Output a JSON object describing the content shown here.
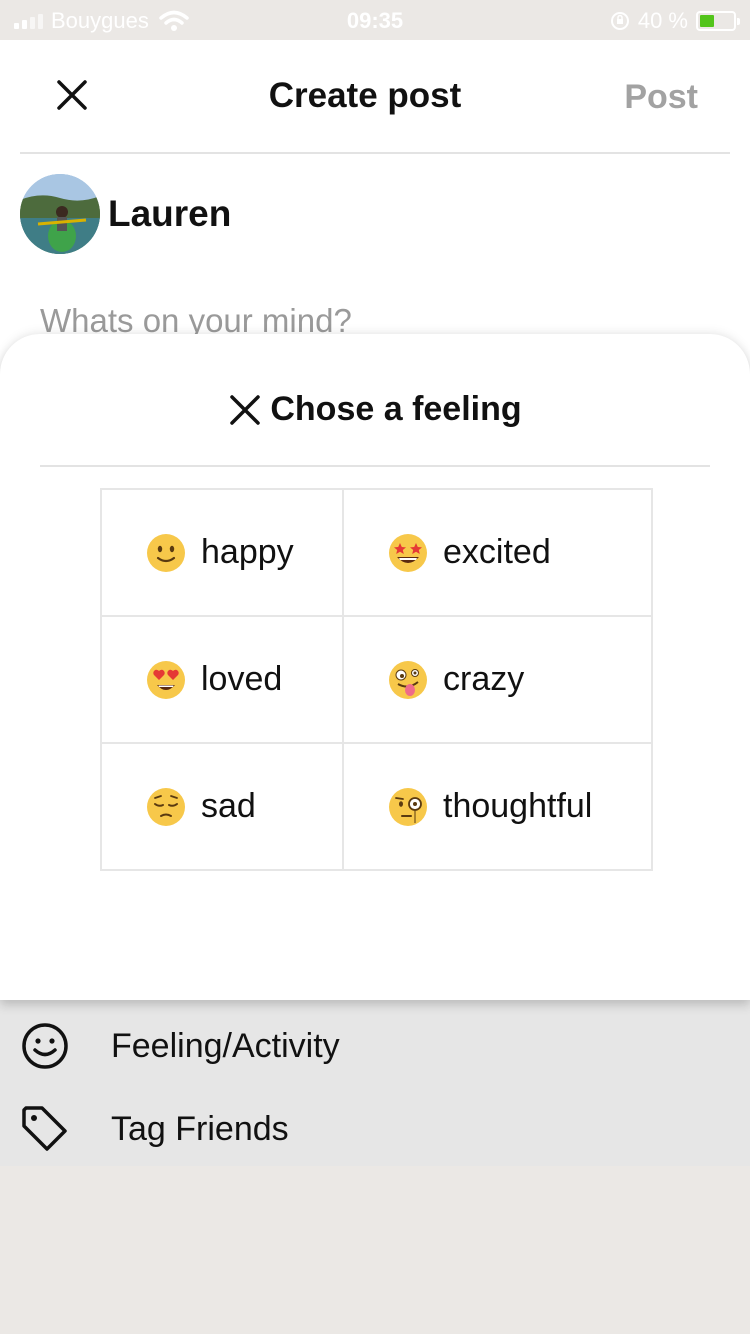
{
  "status_bar": {
    "carrier": "Bouygues",
    "time": "09:35",
    "battery": "40 %"
  },
  "header": {
    "title": "Create post",
    "post_label": "Post"
  },
  "user": {
    "name": "Lauren"
  },
  "composer": {
    "placeholder": "Whats on your mind?"
  },
  "feeling_sheet": {
    "title": "Chose a feeling",
    "feelings": [
      {
        "label": "happy",
        "icon": "slightly-smiling-face-icon"
      },
      {
        "label": "excited",
        "icon": "star-struck-face-icon"
      },
      {
        "label": "loved",
        "icon": "heart-eyes-face-icon"
      },
      {
        "label": "crazy",
        "icon": "zany-face-icon"
      },
      {
        "label": "sad",
        "icon": "pensive-face-icon"
      },
      {
        "label": "thoughtful",
        "icon": "monocle-face-icon"
      }
    ]
  },
  "options": [
    {
      "label": "Feeling/Activity",
      "icon": "smiley-icon"
    },
    {
      "label": "Tag Friends",
      "icon": "tag-icon"
    }
  ],
  "colors": {
    "accent_disabled": "#a2a2a2",
    "emoji_yellow": "#f7c84a",
    "battery_green": "#52c41a"
  }
}
